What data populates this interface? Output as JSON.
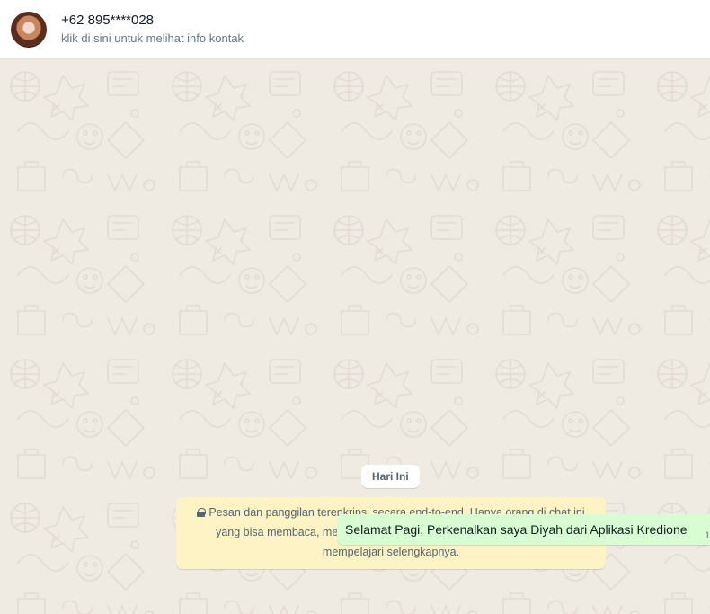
{
  "header": {
    "contact_name": "+62 895****028",
    "contact_subtitle": "klik di sini untuk melihat info kontak"
  },
  "chat": {
    "date_chip": "Hari Ini",
    "encryption_notice": "Pesan dan panggilan terenkripsi secara end-to-end. Hanya orang di chat ini yang bisa membaca, mendengarkan, atau membagikannya. Klik untuk mempelajari selengkapnya.",
    "messages": [
      {
        "direction": "outgoing",
        "text": "Selamat Pagi, Perkenalkan saya Diyah dari Aplikasi Kredione",
        "time_fragment": "1"
      }
    ]
  },
  "colors": {
    "header_bg": "#ffffff",
    "wallpaper_bg": "#efeae2",
    "notice_bg": "#fdf3c5",
    "outgoing_bubble_bg": "#d9fdd3"
  },
  "icons": [
    "contact-avatar",
    "lock-icon"
  ]
}
